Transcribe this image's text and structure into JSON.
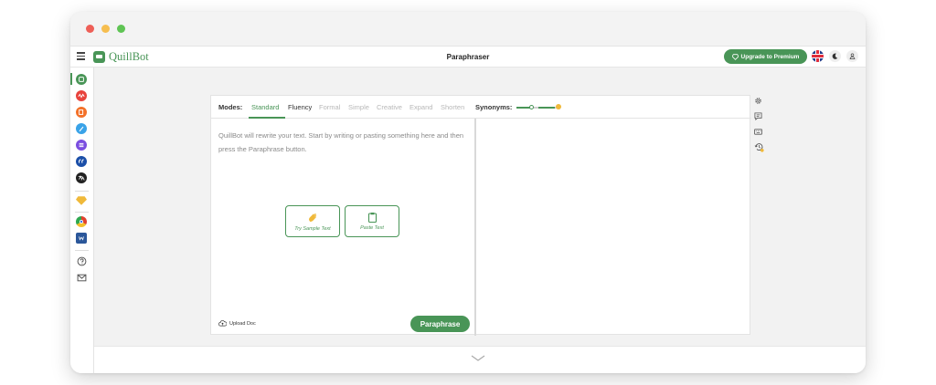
{
  "window": {
    "controls": [
      {
        "name": "close",
        "color": "#ee5f57"
      },
      {
        "name": "minimize",
        "color": "#f6be4f"
      },
      {
        "name": "maximize",
        "color": "#5fc454"
      }
    ]
  },
  "header": {
    "menu_icon": "hamburger-icon",
    "logo_text": "QuillBot",
    "page_title": "Paraphraser",
    "upgrade_label": "Upgrade to Premium",
    "language_icon": "uk-flag-icon",
    "theme_icon": "moon-icon",
    "account_icon": "user-icon"
  },
  "sidebar": {
    "items": [
      {
        "name": "paraphraser",
        "color": "#499557"
      },
      {
        "name": "grammar-checker",
        "color": "#e8433d"
      },
      {
        "name": "plagiarism-checker",
        "color": "#f37129"
      },
      {
        "name": "co-writer",
        "color": "#3aa3e8"
      },
      {
        "name": "summarizer",
        "color": "#7b4ee0"
      },
      {
        "name": "citation-generator",
        "color": "#1b4fa8"
      },
      {
        "name": "translator",
        "color": "#222222"
      },
      {
        "name": "premium",
        "color": "#f0b93a"
      },
      {
        "name": "chrome-extension",
        "color": "#e9a82b"
      },
      {
        "name": "word-addin",
        "color": "#2b579a"
      },
      {
        "name": "help",
        "color": "#555555"
      },
      {
        "name": "contact",
        "color": "#555555"
      }
    ]
  },
  "editor": {
    "modes_label": "Modes:",
    "modes": [
      "Standard",
      "Fluency",
      "Formal",
      "Simple",
      "Creative",
      "Expand",
      "Shorten"
    ],
    "active_mode": "Standard",
    "synonyms_label": "Synonyms:",
    "synonyms_level": 0.33,
    "placeholder": "QuillBot will rewrite your text. Start by writing or pasting something here and then press the Paraphrase button.",
    "sample_button": "Try Sample Text",
    "paste_button": "Paste Text",
    "upload_label": "Upload Doc",
    "paraphrase_button": "Paraphrase"
  },
  "right_tools": [
    "settings-icon",
    "feedback-icon",
    "keyboard-icon",
    "history-icon"
  ],
  "footer": {
    "expand_icon": "chevron-down-icon"
  },
  "colors": {
    "accent": "#499557",
    "premium": "#f0b93a"
  }
}
